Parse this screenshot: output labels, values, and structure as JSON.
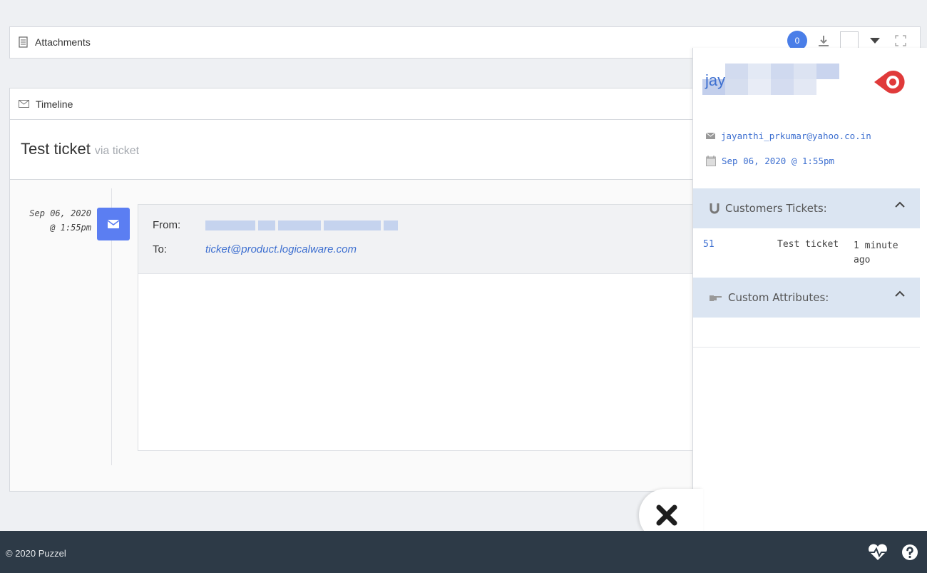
{
  "attachments": {
    "title": "Attachments",
    "count": "0"
  },
  "timeline": {
    "title": "Timeline",
    "subject": "Test ticket",
    "via": "via ticket",
    "date_line1": "Sep 06, 2020",
    "date_line2": "@ 1:55pm",
    "from_label": "From:",
    "to_label": "To:",
    "to_value": "ticket@product.logicalware.com"
  },
  "customer": {
    "name": "jay",
    "email": "jayanthi_prkumar@yahoo.co.in",
    "date": "Sep 06, 2020 @ 1:55pm",
    "tickets_header": "Customers Tickets:",
    "tickets": [
      {
        "id": "51",
        "subject": "Test ticket",
        "age": "1 minute ago"
      }
    ],
    "attributes_header": "Custom Attributes:"
  },
  "footer": {
    "copyright": "© 2020 Puzzel"
  },
  "colors": {
    "accent": "#4a7ee8",
    "link": "#3d6fd0",
    "footer_bg": "#2d3a47",
    "section_bg": "#dbe5f2",
    "pin_red": "#e03a3a"
  },
  "icons": {
    "attachments": "document-icon",
    "timeline": "envelope-icon",
    "download": "download-icon",
    "dropdown": "caret-down-icon",
    "expand": "expand-icon",
    "pin": "pin-icon",
    "customer_email": "envelope-icon",
    "customer_date": "calendar-icon",
    "tickets": "magnet-icon",
    "attributes": "pointing-hand-icon",
    "close": "close-icon",
    "health": "heartbeat-icon",
    "help": "help-icon"
  }
}
